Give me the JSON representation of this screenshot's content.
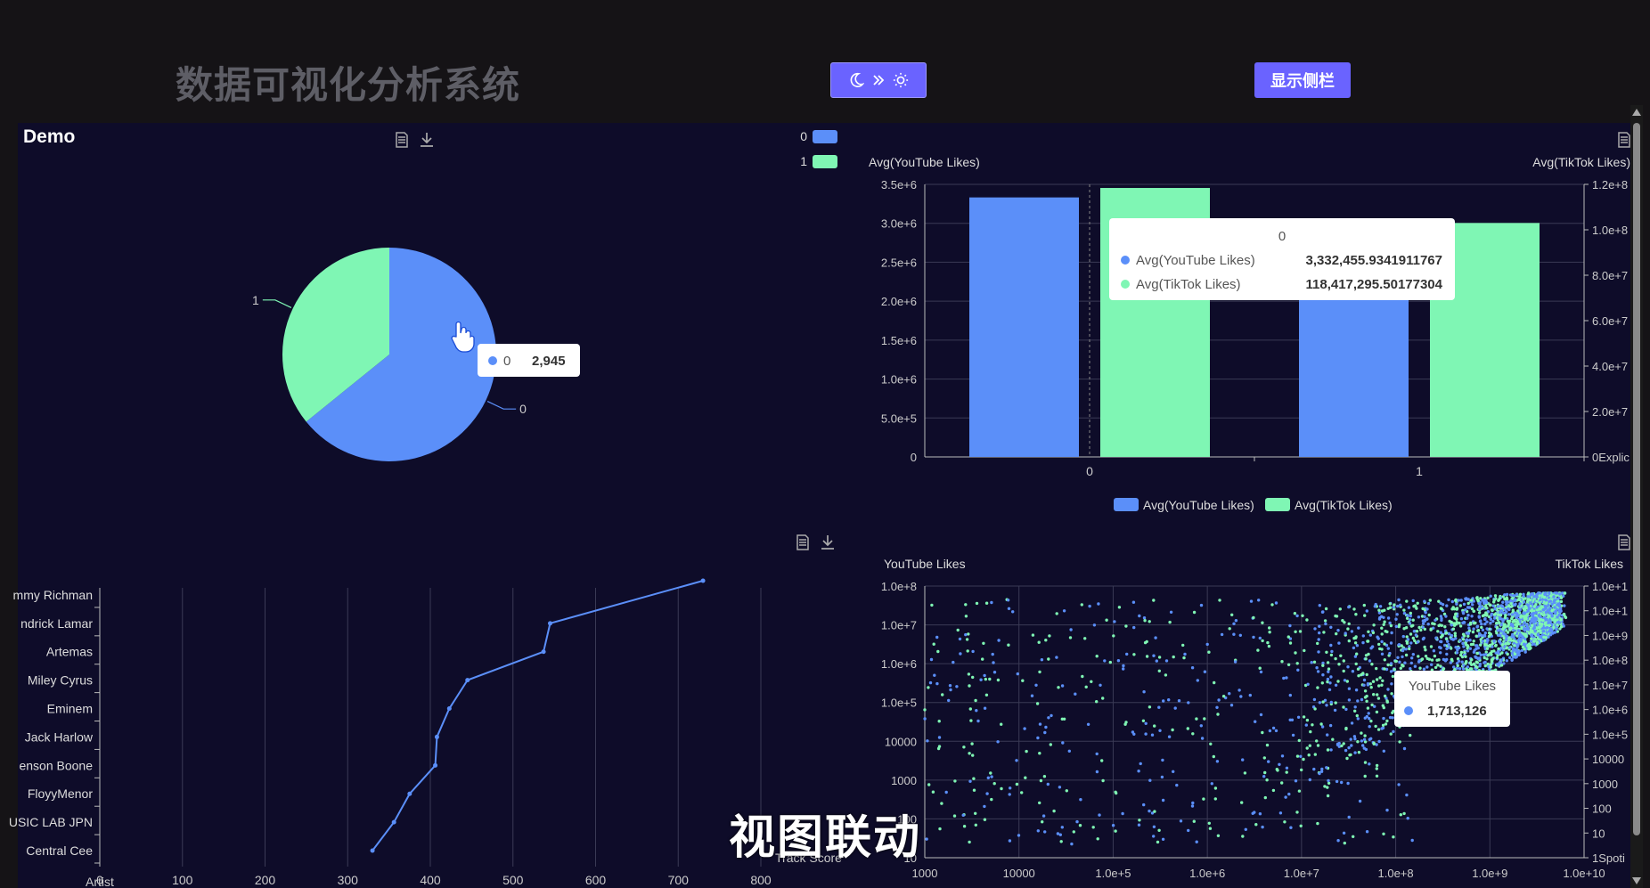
{
  "header": {
    "title": "数据可视化分析系统",
    "theme_toggle": {
      "icons": [
        "moon-icon",
        "double-chevron-icon",
        "sun-icon"
      ]
    },
    "sidebar_button": "显示侧栏"
  },
  "panel": {
    "title": "Demo"
  },
  "subtitle": "视图联动",
  "colors": {
    "blue": "#5b8ff9",
    "green": "#7ff6b4",
    "background": "#0e0c29"
  },
  "chart_data": [
    {
      "type": "pie",
      "slices": [
        {
          "label": "0",
          "value": 2945,
          "color": "#5b8ff9"
        },
        {
          "label": "1",
          "value": 1644,
          "color": "#7ff6b4"
        }
      ],
      "legend": [
        "0",
        "1"
      ],
      "legend_position": "top-right",
      "tooltip": {
        "label": "0",
        "value": "2,945"
      }
    },
    {
      "type": "bar",
      "categories": [
        "0",
        "1"
      ],
      "series": [
        {
          "name": "Avg(YouTube Likes)",
          "axis": "left",
          "values": [
            3332455.93,
            2260000
          ],
          "color": "#5b8ff9"
        },
        {
          "name": "Avg(TikTok Likes)",
          "axis": "right",
          "values": [
            118417295.5,
            103000000
          ],
          "color": "#7ff6b4"
        }
      ],
      "ylabel": "Avg(YouTube Likes)",
      "ylabel_right": "Avg(TikTok Likes)",
      "xlabel_right": "Explic",
      "ylim": [
        0,
        3500000
      ],
      "ylim_right": [
        0,
        120000000
      ],
      "yticks": [
        "0",
        "5.0e+5",
        "1.0e+6",
        "1.5e+6",
        "2.0e+6",
        "2.5e+6",
        "3.0e+6",
        "3.5e+6"
      ],
      "yticks_right": [
        "0",
        "2.0e+7",
        "4.0e+7",
        "6.0e+7",
        "8.0e+7",
        "1.0e+8",
        "1.2e+8"
      ],
      "legend_position": "bottom",
      "tooltip": {
        "title": "0",
        "rows": [
          {
            "label": "Avg(YouTube Likes)",
            "value": "3,332,455.9341911767"
          },
          {
            "label": "Avg(TikTok Likes)",
            "value": "118,417,295.50177304"
          }
        ]
      }
    },
    {
      "type": "line",
      "orientation": "horizontal",
      "categories": [
        "Central Cee",
        "USIC LAB JPN",
        "FloyyMenor",
        "enson Boone",
        "Jack Harlow",
        "Eminem",
        "Miley Cyrus",
        "Artemas",
        "ndrick Lamar",
        "mmy Richman"
      ],
      "points": [
        {
          "x": 330,
          "y": 0
        },
        {
          "x": 356,
          "y": 1
        },
        {
          "x": 375,
          "y": 2
        },
        {
          "x": 406,
          "y": 3
        },
        {
          "x": 408,
          "y": 4
        },
        {
          "x": 423,
          "y": 5
        },
        {
          "x": 445,
          "y": 6
        },
        {
          "x": 537,
          "y": 7
        },
        {
          "x": 545,
          "y": 8
        },
        {
          "x": 730,
          "y": 9.5
        }
      ],
      "xlabel": "Track Score",
      "ylabel": "Artist",
      "xlim": [
        0,
        800
      ],
      "xticks": [
        "0",
        "100",
        "200",
        "300",
        "400",
        "500",
        "600",
        "700",
        "800"
      ],
      "color": "#5b8ff9"
    },
    {
      "type": "scatter",
      "x_scale": "log",
      "y_scale": "log",
      "xlabel": "Spoti",
      "ylabel": "YouTube Likes",
      "ylabel_right": "TikTok Likes",
      "xticks": [
        "1000",
        "10000",
        "1.0e+5",
        "1.0e+6",
        "1.0e+7",
        "1.0e+8",
        "1.0e+9",
        "1.0e+10"
      ],
      "yticks": [
        "10",
        "100",
        "1000",
        "10000",
        "1.0e+5",
        "1.0e+6",
        "1.0e+7",
        "1.0e+8"
      ],
      "yticks_right": [
        "1",
        "10",
        "100",
        "1000",
        "10000",
        "1.0e+5",
        "1.0e+6",
        "1.0e+7",
        "1.0e+8",
        "1.0e+9",
        "1.0e+1",
        "1.0e+1"
      ],
      "series": [
        {
          "name": "YouTube Likes",
          "color": "#5b8ff9"
        },
        {
          "name": "TikTok Likes",
          "color": "#7ff6b4"
        }
      ],
      "tooltip": {
        "title": "YouTube Likes",
        "value": "1,713,126"
      }
    }
  ]
}
